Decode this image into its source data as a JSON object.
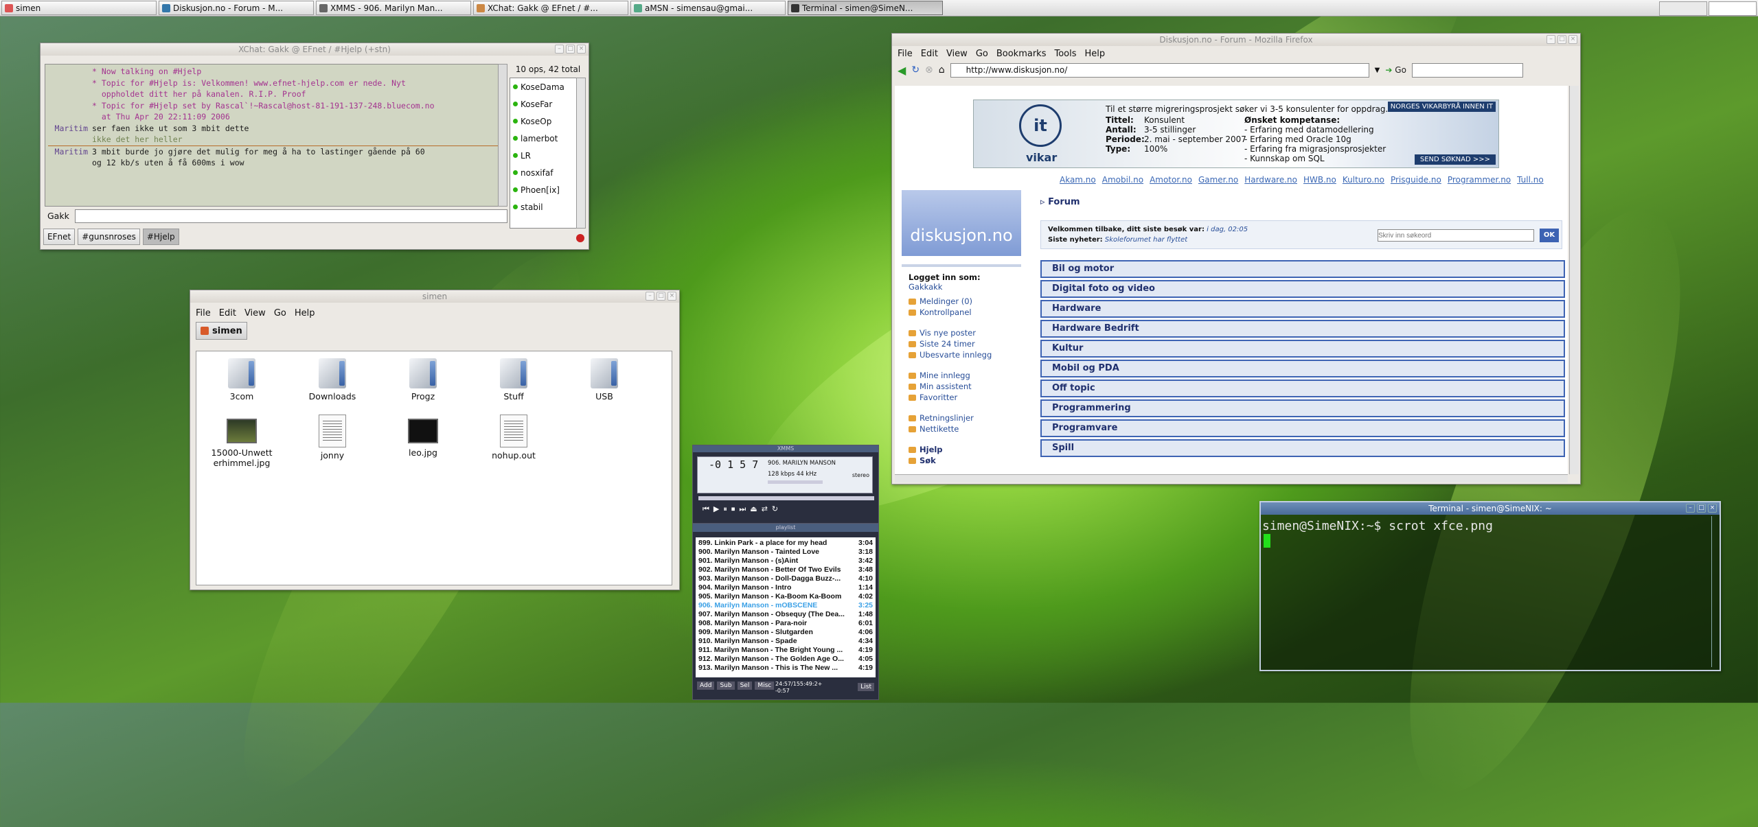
{
  "taskbar": {
    "tasks": [
      {
        "label": "simen",
        "color": "#d55"
      },
      {
        "label": "Diskusjon.no - Forum - M...",
        "color": "#37a"
      },
      {
        "label": "XMMS - 906. Marilyn Man...",
        "color": "#666"
      },
      {
        "label": "XChat: Gakk @ EFnet / #...",
        "color": "#c84"
      },
      {
        "label": "aMSN - simensau@gmai...",
        "color": "#5a8"
      },
      {
        "label": "Terminal - simen@SimeN...",
        "color": "#333"
      }
    ]
  },
  "xchat": {
    "title": "XChat: Gakk @ EFnet / #Hjelp (+stn)",
    "lines": [
      {
        "nick": "",
        "text": "* Now talking on #Hjelp",
        "style": "mag"
      },
      {
        "nick": "",
        "text": "* Topic for #Hjelp is: Velkommen! www.efnet-hjelp.com er nede. Nyt",
        "style": "mag"
      },
      {
        "nick": "",
        "text": "  oppholdet ditt her på kanalen. R.I.P. Proof",
        "style": "mag"
      },
      {
        "nick": "",
        "text": "* Topic for #Hjelp set by Rascal`!~Rascal@host-81-191-137-248.bluecom.no",
        "style": "mag"
      },
      {
        "nick": "",
        "text": "  at Thu Apr 20 22:11:09 2006",
        "style": "mag"
      },
      {
        "nick": "Maritim",
        "text": "ser faen ikke ut som 3 mbit dette",
        "style": ""
      },
      {
        "nick": "",
        "text": "ikke det her heller",
        "style": "olive"
      },
      {
        "nick": "Maritim",
        "text": "3 mbit burde jo gjøre det mulig for meg å ha to lastinger gående på 60",
        "style": ""
      },
      {
        "nick": "",
        "text": "og 12 kb/s uten å få 600ms i wow",
        "style": ""
      }
    ],
    "user_count": "10 ops, 42 total",
    "users": [
      "KoseDama",
      "KoseFar",
      "KoseOp",
      "lamerbot",
      "LR",
      "nosxifaf",
      "Phoen[ix]",
      "stabil"
    ],
    "nick_label": "Gakk",
    "channels": [
      "EFnet",
      "#gunsnroses",
      "#Hjelp"
    ]
  },
  "thunar": {
    "title": "simen",
    "menu": [
      "File",
      "Edit",
      "View",
      "Go",
      "Help"
    ],
    "path_button": "simen",
    "items": [
      {
        "name": "3com",
        "type": "folder"
      },
      {
        "name": "Downloads",
        "type": "folder"
      },
      {
        "name": "Progz",
        "type": "folder"
      },
      {
        "name": "Stuff",
        "type": "folder"
      },
      {
        "name": "USB",
        "type": "folder"
      },
      {
        "name": "15000-Unwetterhimmel.jpg",
        "type": "image"
      },
      {
        "name": "jonny",
        "type": "doc"
      },
      {
        "name": "leo.jpg",
        "type": "image2"
      },
      {
        "name": "nohup.out",
        "type": "doc"
      }
    ]
  },
  "firefox": {
    "title": "Diskusjon.no - Forum - Mozilla Firefox",
    "menu": [
      "File",
      "Edit",
      "View",
      "Go",
      "Bookmarks",
      "Tools",
      "Help"
    ],
    "url": "http://www.diskusjon.no/",
    "go_label": "Go",
    "ad": {
      "headline": "Til et større migreringsprosjekt søker vi 3-5 konsulenter for oppdrag.",
      "rows": [
        [
          "Tittel:",
          "Konsulent"
        ],
        [
          "Antall:",
          "3-5 stillinger"
        ],
        [
          "Periode:",
          "2. mai - september 2007"
        ],
        [
          "Type:",
          "100%"
        ]
      ],
      "skills_title": "Ønsket kompetanse:",
      "skills": [
        "- Erfaring med datamodellering",
        "- Erfaring med Oracle 10g",
        "- Erfaring fra migrasjonsprosjekter",
        "- Kunnskap om SQL"
      ],
      "badge": "NORGES VIKARBYRÅ INNEN IT",
      "apply": "SEND SØKNAD >>>",
      "brand": "vikar"
    },
    "top_links": [
      "Akam.no",
      "Amobil.no",
      "Amotor.no",
      "Gamer.no",
      "Hardware.no",
      "HWB.no",
      "Kulturo.no",
      "Prisguide.no",
      "Programmer.no",
      "Tull.no"
    ],
    "logo": "diskusjon.no",
    "breadcrumb": "Forum",
    "welcome": "Velkommen tilbake, ditt siste besøk var:",
    "welcome_time": "i dag, 02:05",
    "news_label": "Siste nyheter:",
    "news_text": "Skoleforumet har flyttet",
    "search_placeholder": "Skriv inn søkeord",
    "search_ok": "OK",
    "logged_in": "Logget inn som:",
    "user": "Gakkakk",
    "side_groups": [
      [
        "Meldinger (0)",
        "Kontrollpanel"
      ],
      [
        "Vis nye poster",
        "Siste 24 timer",
        "Ubesvarte innlegg"
      ],
      [
        "Mine innlegg",
        "Min assistent",
        "Favoritter"
      ],
      [
        "Retningslinjer",
        "Nettikette"
      ],
      [
        "Hjelp",
        "Søk"
      ]
    ],
    "forums": [
      "Bil og motor",
      "Digital foto og video",
      "Hardware",
      "Hardware Bedrift",
      "Kultur",
      "Mobil og PDA",
      "Off topic",
      "Programmering",
      "Programvare",
      "Spill"
    ]
  },
  "xmms": {
    "title": "XMMS",
    "time": "-0 1 5 7",
    "song": "906. MARILYN MANSON",
    "kbps": "128",
    "khz": "44",
    "stereo": "stereo",
    "playlist_title": "playlist",
    "playlist": [
      {
        "t": "899. Linkin Park - a place for my head",
        "d": "3:04"
      },
      {
        "t": "900. Marilyn Manson - Tainted Love",
        "d": "3:18"
      },
      {
        "t": "901. Marilyn Manson - (s)Aint",
        "d": "3:42"
      },
      {
        "t": "902. Marilyn Manson - Better Of Two Evils",
        "d": "3:48"
      },
      {
        "t": "903. Marilyn Manson - Doll-Dagga Buzz-...",
        "d": "4:10"
      },
      {
        "t": "904. Marilyn Manson - Intro",
        "d": "1:14"
      },
      {
        "t": "905. Marilyn Manson - Ka-Boom Ka-Boom",
        "d": "4:02"
      },
      {
        "t": "906. Marilyn Manson - mOBSCENE",
        "d": "3:25"
      },
      {
        "t": "907. Marilyn Manson - Obsequy (The Dea...",
        "d": "1:48"
      },
      {
        "t": "908. Marilyn Manson - Para-noir",
        "d": "6:01"
      },
      {
        "t": "909. Marilyn Manson - Slutgarden",
        "d": "4:06"
      },
      {
        "t": "910. Marilyn Manson - Spade",
        "d": "4:34"
      },
      {
        "t": "911. Marilyn Manson - The Bright Young ...",
        "d": "4:19"
      },
      {
        "t": "912. Marilyn Manson - The Golden Age O...",
        "d": "4:05"
      },
      {
        "t": "913. Marilyn Manson - This is The New ...",
        "d": "4:19"
      }
    ],
    "current_index": 7,
    "pl_buttons": [
      "Add",
      "Sub",
      "Sel",
      "Misc"
    ],
    "pl_list": "List",
    "pl_time": "24:57/155:49:2+",
    "pl_time2": "-0:57"
  },
  "terminal": {
    "title": "Terminal - simen@SimeNIX: ~",
    "line": "simen@SimeNIX:~$ scrot xfce.png"
  }
}
